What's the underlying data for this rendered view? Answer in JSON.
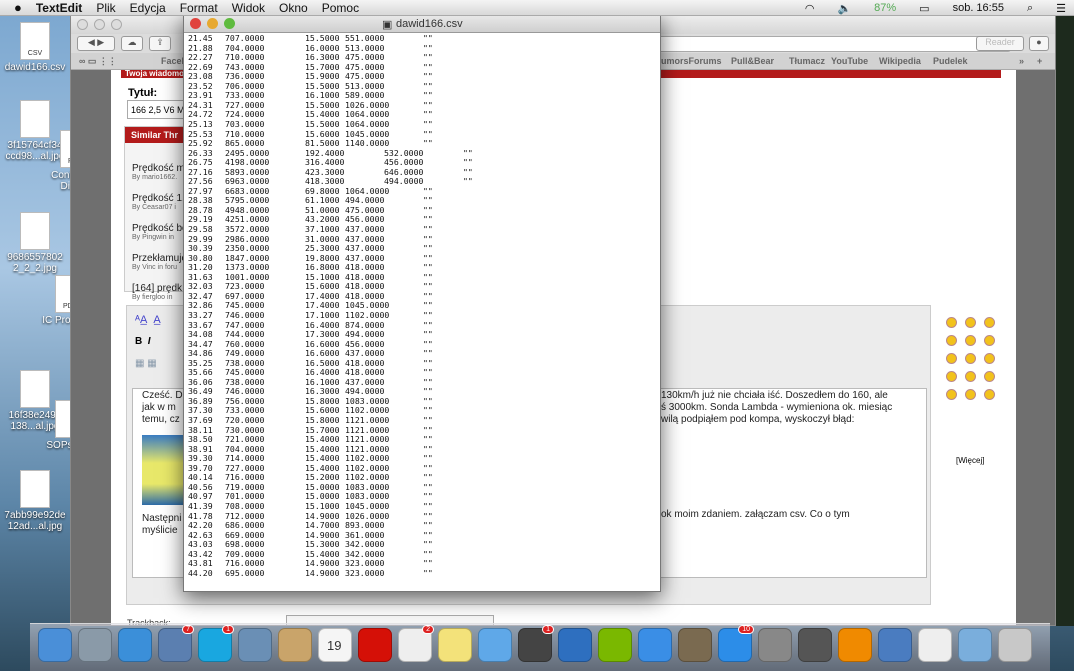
{
  "menubar": {
    "app": "TextEdit",
    "items": [
      "Plik",
      "Edycja",
      "Format",
      "Widok",
      "Okno",
      "Pomoc"
    ],
    "battery": "87%",
    "clock": "sob. 16:55"
  },
  "desktop": {
    "icons": [
      {
        "label": "dawid166.csv",
        "kind": "CSV"
      },
      {
        "label": "3f15764cf34 ccd98...al.jpg",
        "kind": ""
      },
      {
        "label": "Confiden y Diabet",
        "kind": "PDF"
      },
      {
        "label": "9686557802 2_2_2.jpg",
        "kind": ""
      },
      {
        "label": "IC Proce...et",
        "kind": "PDF"
      },
      {
        "label": "16f38e2499 138...al.jpg",
        "kind": ""
      },
      {
        "label": "SOPs rials",
        "kind": ""
      },
      {
        "label": "7abb99e92de 12ad...al.jpg",
        "kind": ""
      }
    ]
  },
  "browser": {
    "reader": "Reader",
    "bookmarks": [
      "Facebook",
      "umorsForums",
      "Pull&Bear",
      "Tłumacz",
      "YouTube",
      "Wikipedia",
      "Pudelek"
    ],
    "more": "»",
    "page": {
      "header": "Twoja wiadomość",
      "title_label": "Tytuł:",
      "title_value": "166 2,5 V6 Mo",
      "similar_header": "Similar Thr",
      "similar": [
        {
          "t": "Prędkość m",
          "by": "By mario1662."
        },
        {
          "t": "Prędkość 1.",
          "by": "By Ceasar07 i"
        },
        {
          "t": "Prędkość bo",
          "by": "By Pingwin in"
        },
        {
          "t": "Przekłamuje",
          "by": "By Vinc in foru"
        },
        {
          "t": "[164] prędk",
          "by": "By fiergloo in"
        }
      ],
      "post_left": [
        "Cześć. D",
        "jak w m",
        "temu, cz",
        "Następni",
        "myślicie"
      ],
      "post_right": [
        "130km/h już nie chciała iść. Doszedłem do 160, ale",
        "ś 3000km. Sonda Lambda - wymieniona ok. miesiąc",
        "wilą podpiąłem pod kompa, wyskoczył błąd:",
        "ok moim zdaniem. załączam csv. Co o tym"
      ],
      "more_smilies": "[Więcej]",
      "trackback": "Trackback:"
    }
  },
  "textedit": {
    "title": "dawid166.csv",
    "rows": [
      [
        "21.45",
        "707.0000",
        "15.5000",
        "551.0000",
        "\"\""
      ],
      [
        "21.88",
        "704.0000",
        "16.0000",
        "513.0000",
        "\"\""
      ],
      [
        "22.27",
        "710.0000",
        "16.3000",
        "475.0000",
        "\"\""
      ],
      [
        "22.69",
        "743.0000",
        "15.7000",
        "475.0000",
        "\"\""
      ],
      [
        "23.08",
        "736.0000",
        "15.9000",
        "475.0000",
        "\"\""
      ],
      [
        "23.52",
        "706.0000",
        "15.5000",
        "513.0000",
        "\"\""
      ],
      [
        "23.91",
        "733.0000",
        "16.1000",
        "589.0000",
        "\"\""
      ],
      [
        "24.31",
        "727.0000",
        "15.5000",
        "1026.0000",
        "\"\""
      ],
      [
        "24.72",
        "724.0000",
        "15.4000",
        "1064.0000",
        "\"\""
      ],
      [
        "25.13",
        "703.0000",
        "15.5000",
        "1064.0000",
        "\"\""
      ],
      [
        "25.53",
        "710.0000",
        "15.6000",
        "1045.0000",
        "\"\""
      ],
      [
        "25.92",
        "865.0000",
        "81.5000",
        "1140.0000",
        "\"\""
      ],
      [
        "26.33",
        "2495.0000",
        "192.4000",
        "532.0000",
        "\"\""
      ],
      [
        "26.75",
        "4198.0000",
        "316.4000",
        "456.0000",
        "\"\""
      ],
      [
        "27.16",
        "5893.0000",
        "423.3000",
        "646.0000",
        "\"\""
      ],
      [
        "27.56",
        "6963.0000",
        "418.3000",
        "494.0000",
        "\"\""
      ],
      [
        "27.97",
        "6683.0000",
        "69.8000",
        "1064.0000",
        "\"\""
      ],
      [
        "28.38",
        "5795.0000",
        "61.1000",
        "494.0000",
        "\"\""
      ],
      [
        "28.78",
        "4948.0000",
        "51.0000",
        "475.0000",
        "\"\""
      ],
      [
        "29.19",
        "4251.0000",
        "43.2000",
        "456.0000",
        "\"\""
      ],
      [
        "29.58",
        "3572.0000",
        "37.1000",
        "437.0000",
        "\"\""
      ],
      [
        "29.99",
        "2986.0000",
        "31.0000",
        "437.0000",
        "\"\""
      ],
      [
        "30.39",
        "2350.0000",
        "25.3000",
        "437.0000",
        "\"\""
      ],
      [
        "30.80",
        "1847.0000",
        "19.8000",
        "437.0000",
        "\"\""
      ],
      [
        "31.20",
        "1373.0000",
        "16.8000",
        "418.0000",
        "\"\""
      ],
      [
        "31.63",
        "1001.0000",
        "15.1000",
        "418.0000",
        "\"\""
      ],
      [
        "32.03",
        "723.0000",
        "15.6000",
        "418.0000",
        "\"\""
      ],
      [
        "32.47",
        "697.0000",
        "17.4000",
        "418.0000",
        "\"\""
      ],
      [
        "32.86",
        "745.0000",
        "17.4000",
        "1045.0000",
        "\"\""
      ],
      [
        "33.27",
        "746.0000",
        "17.1000",
        "1102.0000",
        "\"\""
      ],
      [
        "33.67",
        "747.0000",
        "16.4000",
        "874.0000",
        "\"\""
      ],
      [
        "34.08",
        "744.0000",
        "17.3000",
        "494.0000",
        "\"\""
      ],
      [
        "34.47",
        "760.0000",
        "16.6000",
        "456.0000",
        "\"\""
      ],
      [
        "34.86",
        "749.0000",
        "16.6000",
        "437.0000",
        "\"\""
      ],
      [
        "35.25",
        "738.0000",
        "16.5000",
        "418.0000",
        "\"\""
      ],
      [
        "35.66",
        "745.0000",
        "16.4000",
        "418.0000",
        "\"\""
      ],
      [
        "36.06",
        "738.0000",
        "16.1000",
        "437.0000",
        "\"\""
      ],
      [
        "36.49",
        "746.0000",
        "16.3000",
        "494.0000",
        "\"\""
      ],
      [
        "36.89",
        "756.0000",
        "15.8000",
        "1083.0000",
        "\"\""
      ],
      [
        "37.30",
        "733.0000",
        "15.6000",
        "1102.0000",
        "\"\""
      ],
      [
        "37.69",
        "720.0000",
        "15.8000",
        "1121.0000",
        "\"\""
      ],
      [
        "38.11",
        "730.0000",
        "15.7000",
        "1121.0000",
        "\"\""
      ],
      [
        "38.50",
        "721.0000",
        "15.4000",
        "1121.0000",
        "\"\""
      ],
      [
        "38.91",
        "704.0000",
        "15.4000",
        "1121.0000",
        "\"\""
      ],
      [
        "39.30",
        "714.0000",
        "15.4000",
        "1102.0000",
        "\"\""
      ],
      [
        "39.70",
        "727.0000",
        "15.4000",
        "1102.0000",
        "\"\""
      ],
      [
        "40.14",
        "716.0000",
        "15.2000",
        "1102.0000",
        "\"\""
      ],
      [
        "40.56",
        "719.0000",
        "15.0000",
        "1083.0000",
        "\"\""
      ],
      [
        "40.97",
        "701.0000",
        "15.0000",
        "1083.0000",
        "\"\""
      ],
      [
        "41.39",
        "708.0000",
        "15.1000",
        "1045.0000",
        "\"\""
      ],
      [
        "41.78",
        "712.0000",
        "14.9000",
        "1026.0000",
        "\"\""
      ],
      [
        "42.20",
        "686.0000",
        "14.7000",
        "893.0000",
        "\"\""
      ],
      [
        "42.63",
        "669.0000",
        "14.9000",
        "361.0000",
        "\"\""
      ],
      [
        "43.03",
        "698.0000",
        "15.3000",
        "342.0000",
        "\"\""
      ],
      [
        "43.42",
        "709.0000",
        "15.4000",
        "342.0000",
        "\"\""
      ],
      [
        "43.81",
        "716.0000",
        "14.9000",
        "323.0000",
        "\"\""
      ],
      [
        "44.20",
        "695.0000",
        "14.9000",
        "323.0000",
        "\"\""
      ]
    ]
  },
  "dock": {
    "apps": [
      {
        "name": "finder",
        "color": "#4a8fd8"
      },
      {
        "name": "launchpad",
        "color": "#8a9aa8"
      },
      {
        "name": "safari",
        "color": "#3b8fd9"
      },
      {
        "name": "mail-bird",
        "color": "#5b7fb0",
        "badge": "7"
      },
      {
        "name": "skype",
        "color": "#19a7e0",
        "badge": "1"
      },
      {
        "name": "preview",
        "color": "#6a8fb5"
      },
      {
        "name": "contacts",
        "color": "#c9a46a"
      },
      {
        "name": "calendar",
        "color": "#f5f5f5",
        "text": "19"
      },
      {
        "name": "lastfm",
        "color": "#d51007"
      },
      {
        "name": "reminders",
        "color": "#eeeeee",
        "badge": "2"
      },
      {
        "name": "notes",
        "color": "#f3e27a"
      },
      {
        "name": "messages",
        "color": "#5fa8e8"
      },
      {
        "name": "facetime",
        "color": "#444444",
        "badge": "1"
      },
      {
        "name": "quicktime",
        "color": "#2e6fbf"
      },
      {
        "name": "spotify",
        "color": "#7ab800"
      },
      {
        "name": "itunes",
        "color": "#3a8ee6"
      },
      {
        "name": "iphoto",
        "color": "#7a6a50"
      },
      {
        "name": "app-store",
        "color": "#2c8de8",
        "badge": "10"
      },
      {
        "name": "system-preferences",
        "color": "#888888"
      },
      {
        "name": "instacast",
        "color": "#555555"
      },
      {
        "name": "vlc",
        "color": "#f08a00"
      },
      {
        "name": "screen-app",
        "color": "#4a7cc0"
      },
      {
        "name": "textedit",
        "color": "#eeeeee"
      },
      {
        "name": "folder",
        "color": "#7aaedc"
      },
      {
        "name": "trash",
        "color": "#c8c8c8"
      }
    ]
  }
}
